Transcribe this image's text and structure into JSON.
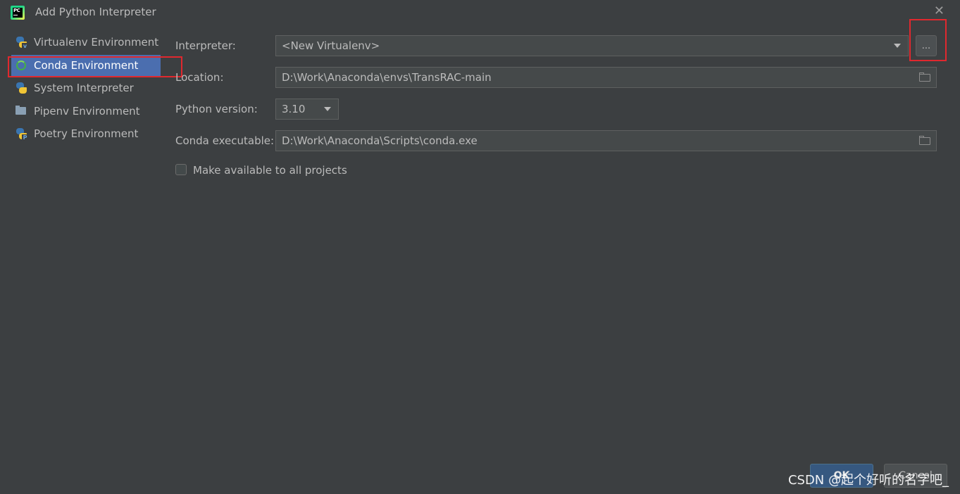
{
  "window": {
    "title": "Add Python Interpreter",
    "close_glyph": "✕"
  },
  "sidebar": {
    "items": [
      {
        "label": "Virtualenv Environment",
        "icon": "python-icon"
      },
      {
        "label": "Conda Environment",
        "icon": "conda-icon",
        "selected": true
      },
      {
        "label": "System Interpreter",
        "icon": "python-icon"
      },
      {
        "label": "Pipenv Environment",
        "icon": "pipenv-icon"
      },
      {
        "label": "Poetry Environment",
        "icon": "python-icon"
      }
    ]
  },
  "form": {
    "interpreter_label": "Interpreter:",
    "interpreter_value": "<New Virtualenv>",
    "browse_label": "...",
    "location_label": "Location:",
    "location_value": "D:\\Work\\Anaconda\\envs\\TransRAC-main",
    "python_version_label": "Python version:",
    "python_version_value": "3.10",
    "conda_exec_label": "Conda executable:",
    "conda_exec_value": "D:\\Work\\Anaconda\\Scripts\\conda.exe",
    "make_available_label": "Make available to all projects",
    "make_available_checked": false
  },
  "buttons": {
    "ok_label": "OK",
    "cancel_label": "Cancel"
  },
  "watermark": "CSDN @起个好听的名字吧_",
  "colors": {
    "background": "#3c3f41",
    "selection": "#4b6eaf",
    "highlight_box": "#e0282e"
  }
}
